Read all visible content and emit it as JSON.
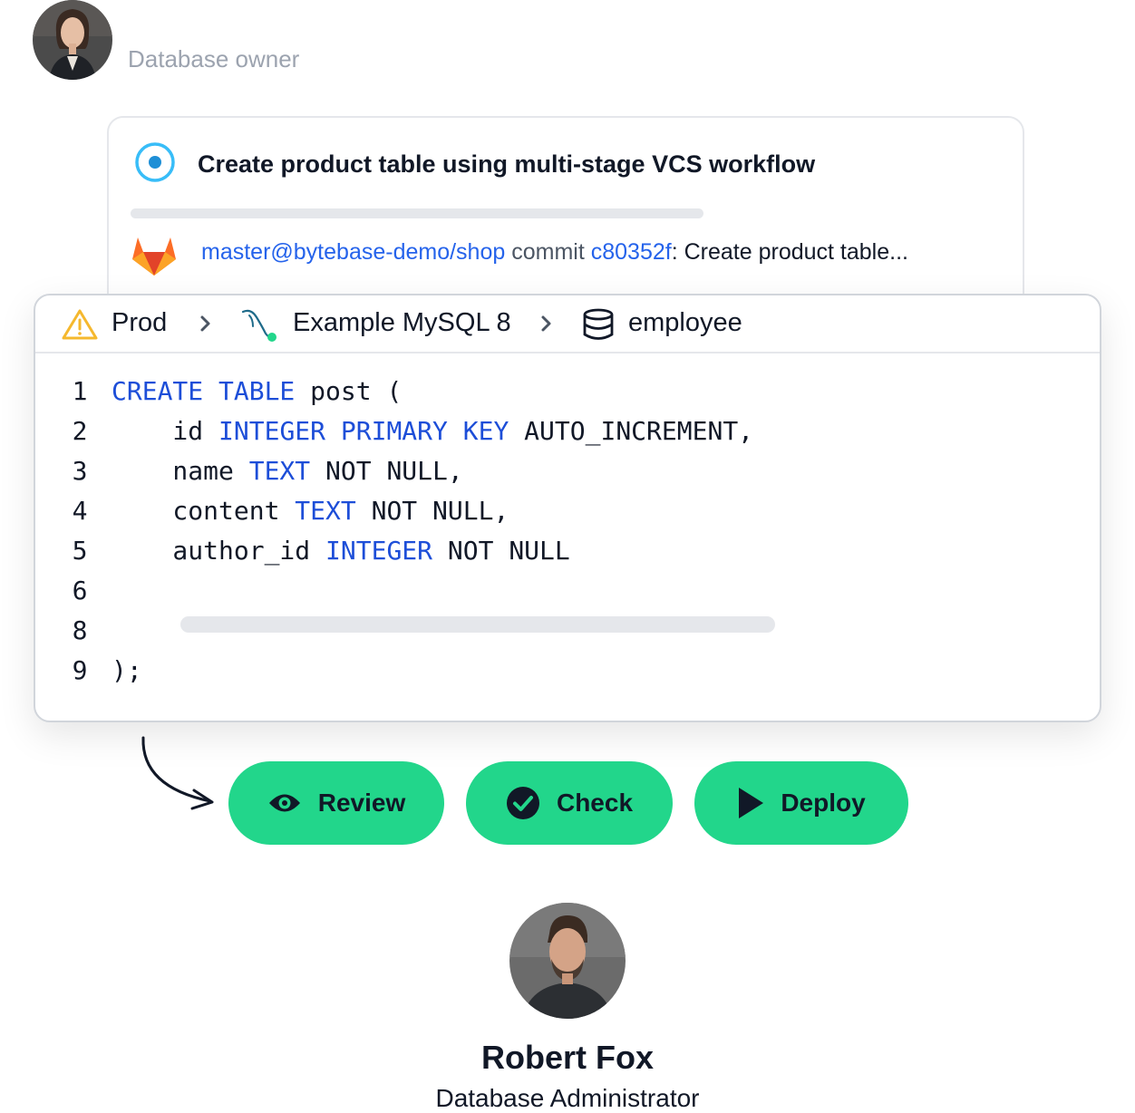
{
  "owner": {
    "role_label": "Database owner"
  },
  "task": {
    "title": "Create product table using multi-stage VCS workflow",
    "repo_ref": "master@bytebase-demo/shop",
    "commit_word": "commit",
    "commit_hash": "c80352f",
    "commit_message": ": Create product table..."
  },
  "editor": {
    "breadcrumb": {
      "environment": "Prod",
      "instance": "Example MySQL 8",
      "database": "employee"
    },
    "lines": [
      {
        "num": "1",
        "tokens": [
          {
            "t": "CREATE TABLE",
            "kw": true
          },
          {
            "t": " post (",
            "kw": false
          }
        ]
      },
      {
        "num": "2",
        "tokens": [
          {
            "t": "    id ",
            "kw": false
          },
          {
            "t": "INTEGER PRIMARY KEY",
            "kw": true
          },
          {
            "t": " AUTO_INCREMENT,",
            "kw": false
          }
        ]
      },
      {
        "num": "3",
        "tokens": [
          {
            "t": "    name ",
            "kw": false
          },
          {
            "t": "TEXT",
            "kw": true
          },
          {
            "t": " NOT NULL,",
            "kw": false
          }
        ]
      },
      {
        "num": "4",
        "tokens": [
          {
            "t": "    content ",
            "kw": false
          },
          {
            "t": "TEXT",
            "kw": true
          },
          {
            "t": " NOT NULL,",
            "kw": false
          }
        ]
      },
      {
        "num": "5",
        "tokens": [
          {
            "t": "    author_id ",
            "kw": false
          },
          {
            "t": "INTEGER",
            "kw": true
          },
          {
            "t": " NOT NULL",
            "kw": false
          }
        ]
      },
      {
        "num": "6",
        "tokens": []
      },
      {
        "num": "8",
        "tokens": []
      },
      {
        "num": "9",
        "tokens": [
          {
            "t": ");",
            "kw": false
          }
        ]
      }
    ]
  },
  "actions": {
    "review_label": "Review",
    "check_label": "Check",
    "deploy_label": "Deploy"
  },
  "admin": {
    "name": "Robert Fox",
    "role": "Database Administrator"
  },
  "colors": {
    "accent_green": "#22d68b",
    "link_blue": "#2563eb",
    "keyword_blue": "#1d4ed8",
    "radio_blue": "#38bdf8",
    "warning_yellow": "#f5b82e",
    "gitlab_orange": "#e24329"
  },
  "icons": [
    "radio-icon",
    "gitlab-icon",
    "warning-icon",
    "mysql-icon",
    "database-icon",
    "chevron-right-icon",
    "eye-icon",
    "check-circle-icon",
    "play-icon",
    "curved-arrow-icon"
  ]
}
